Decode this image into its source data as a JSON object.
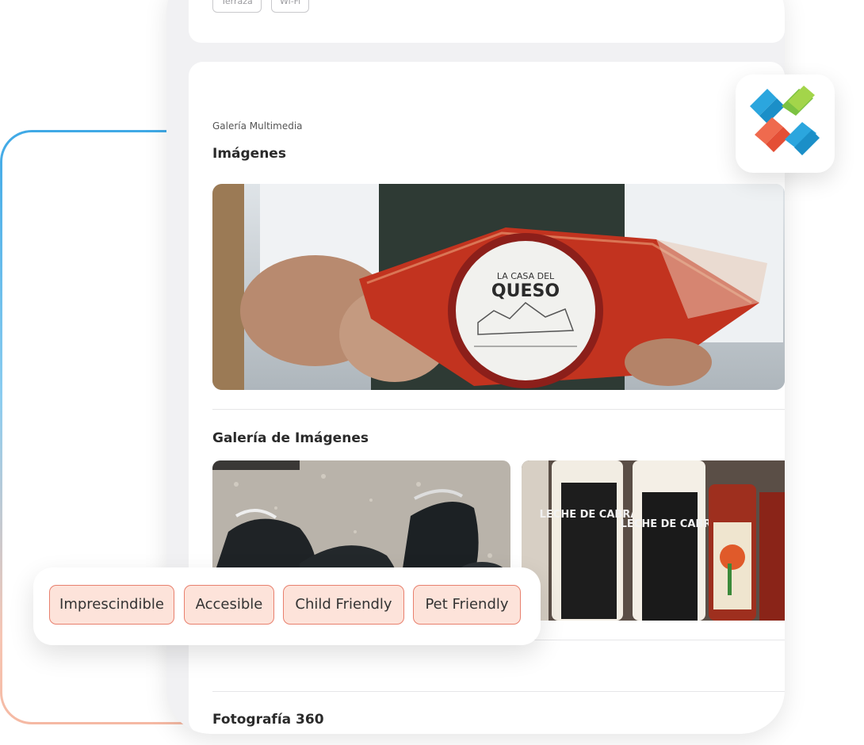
{
  "top_chips": [
    "Terraza",
    "Wi-Fi"
  ],
  "gallery": {
    "caption": "Galería Multimedia",
    "images_title": "Imágenes",
    "gallery_title": "Galería de Imágenes",
    "photo360_title": "Fotografía 360"
  },
  "hero_image": {
    "label_line1": "LA CASA DEL",
    "label_line2": "QUESO"
  },
  "thumbs": [
    {
      "name": "goats-photo"
    },
    {
      "name": "goat-milk-bottles-photo",
      "bottle_text_1": "LECHE DE CABRA",
      "bottle_text_2": "LECHE DE CABRA"
    }
  ],
  "tags": [
    "Imprescindible",
    "Accesible",
    "Child Friendly",
    "Pet Friendly"
  ],
  "colors": {
    "tag_bg": "#fde3da",
    "tag_border": "#e8806e",
    "outline_top": "#3fa9e6",
    "outline_bottom": "#f5b9a3"
  }
}
